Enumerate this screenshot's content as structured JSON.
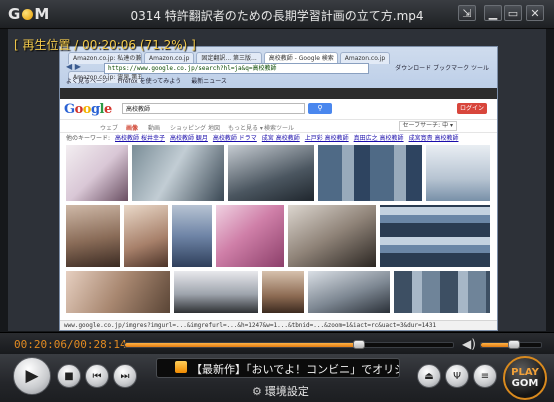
{
  "app": {
    "logo": "GOM",
    "title": "0314 特許翻訳者のための長期学習計画の立て方.mp4",
    "window_buttons": [
      "restore-down-icon",
      "minimize-icon",
      "maximize-icon",
      "close-icon"
    ]
  },
  "video": {
    "osd_text": "[ 再生位置 / 00:20:06 (71.2%) ]",
    "browser": {
      "tabs": [
        "Amazon.co.jp: 私達の兼し...",
        "Amazon.co.jp",
        "固定翻訳... 第三版...",
        "高校教師 - Google 検索",
        "Amazon.co.jp",
        "Amazon.co.jp: 霊泉 第五章..."
      ],
      "address": "https://www.google.co.jp/search?hl=ja&q=高校教師",
      "bookmarks": [
        "よく見るページ",
        "Firefox を使ってみよう",
        "最新ニュース"
      ],
      "right_menu": "ダウンロード  ブックマーク  ツール",
      "google_query": "高校教師",
      "login_label": "ログイン",
      "search_tabs": [
        "ウェブ",
        "画像",
        "動画",
        "ショッピング",
        "地図",
        "もっと見る ▾",
        "検索ツール"
      ],
      "active_search_tab": "画像",
      "safesearch": "セーフサーチ: 中 ▾",
      "related_label": "他のキーワード:",
      "related": [
        "高校教師 桜井幸子",
        "高校教師 観月",
        "高校教師 ドラマ",
        "成宮 高校教師",
        "上戸彩 高校教師",
        "真田広之 高校教師",
        "成宮寛貴 高校教師"
      ],
      "status_url": "www.google.co.jp/imgres?imgurl=...&imgrefurl=...&h=1247&w=1...&tbnid=...&zoom=1&iact=rc&uact=3&dur=1431"
    }
  },
  "playback": {
    "time_display": "00:20:06/00:28:14",
    "progress": 0.712,
    "volume": 0.55
  },
  "controls": {
    "ticker_text": "【最新作】「おいでよ！コンビニ」でオリジ...",
    "settings_label": "環境設定",
    "playgom_line1": "PLAY",
    "playgom_line2": "GOM"
  }
}
